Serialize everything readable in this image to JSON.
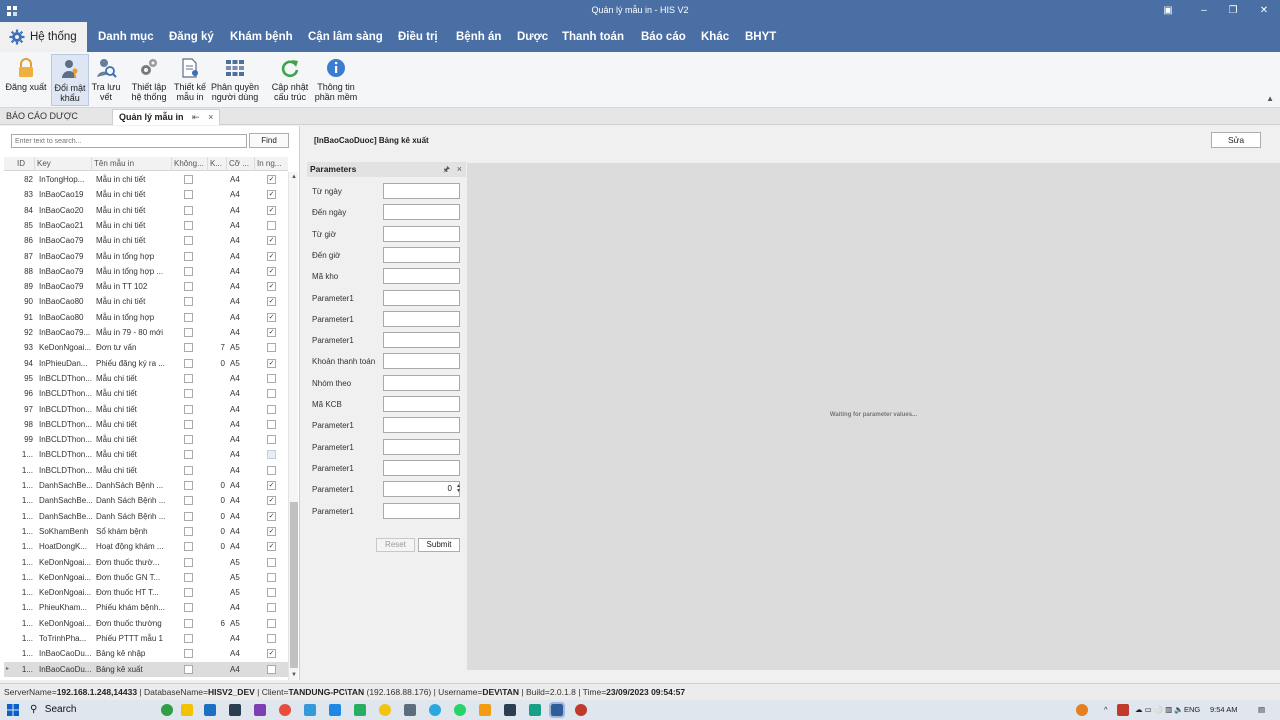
{
  "window": {
    "title": "Quản lý mẫu in - HIS V2",
    "minimize_icon": "minimize-icon",
    "maximize_icon": "restore-icon",
    "close_icon": "close-icon"
  },
  "ribbon_tabs": [
    {
      "label": "Hệ thống",
      "active": true
    },
    {
      "label": "Danh mục"
    },
    {
      "label": "Đăng ký"
    },
    {
      "label": "Khám bệnh"
    },
    {
      "label": "Cận lâm sàng"
    },
    {
      "label": "Điều trị"
    },
    {
      "label": "Bệnh án"
    },
    {
      "label": "Dược"
    },
    {
      "label": "Thanh toán"
    },
    {
      "label": "Báo cáo"
    },
    {
      "label": "Khác"
    },
    {
      "label": "BHYT"
    }
  ],
  "ribbon_buttons": [
    {
      "line1": "Đăng xuất",
      "line2": "",
      "icon": "lock-icon"
    },
    {
      "line1": "Đổi mật",
      "line2": "khẩu",
      "icon": "user-key-icon"
    },
    {
      "line1": "Tra lưu",
      "line2": "vết",
      "icon": "user-search-icon"
    },
    {
      "line1": "Thiết lập",
      "line2": "hệ thống",
      "icon": "gears-icon"
    },
    {
      "line1": "Thiết kế",
      "line2": "mẫu in",
      "icon": "document-design-icon"
    },
    {
      "line1": "Phân quyền",
      "line2": "người dùng",
      "icon": "grid-users-icon"
    },
    {
      "line1": "Cập nhật",
      "line2": "cấu trúc",
      "icon": "refresh-icon"
    },
    {
      "line1": "Thông tin",
      "line2": "phần mềm",
      "icon": "info-icon"
    }
  ],
  "doc_tabs": [
    {
      "label": "BÁO CÁO DƯỢC"
    },
    {
      "label": "Quản lý mẫu in",
      "active": true,
      "pin": "⇤",
      "close": "×"
    }
  ],
  "search": {
    "placeholder": "Enter text to search...",
    "find_label": "Find"
  },
  "grid": {
    "headers": [
      "ID",
      "Key",
      "Tên mẫu in",
      "Không...",
      "K...",
      "Cỡ ...",
      "In ng..."
    ],
    "rows": [
      {
        "id": "82",
        "key": "InTongHop...",
        "name": "Mẫu in chi tiết",
        "k": "",
        "size": "A4",
        "c1": false,
        "c2": true
      },
      {
        "id": "83",
        "key": "InBaoCao19",
        "name": "Mẫu in chi tiết",
        "k": "",
        "size": "A4",
        "c1": false,
        "c2": true
      },
      {
        "id": "84",
        "key": "InBaoCao20",
        "name": "Mẫu in chi tiết",
        "k": "",
        "size": "A4",
        "c1": false,
        "c2": true
      },
      {
        "id": "85",
        "key": "InBaoCao21",
        "name": "Mẫu in chi tiết",
        "k": "",
        "size": "A4",
        "c1": false,
        "c2": false
      },
      {
        "id": "86",
        "key": "InBaoCao79",
        "name": "Mẫu in chi tiết",
        "k": "",
        "size": "A4",
        "c1": false,
        "c2": true
      },
      {
        "id": "87",
        "key": "InBaoCao79",
        "name": "Mẫu in tổng hợp",
        "k": "",
        "size": "A4",
        "c1": false,
        "c2": true
      },
      {
        "id": "88",
        "key": "InBaoCao79",
        "name": "Mẫu in tổng hợp ...",
        "k": "",
        "size": "A4",
        "c1": false,
        "c2": true
      },
      {
        "id": "89",
        "key": "InBaoCao79",
        "name": "Mẫu in TT 102",
        "k": "",
        "size": "A4",
        "c1": false,
        "c2": true
      },
      {
        "id": "90",
        "key": "InBaoCao80",
        "name": "Mẫu in chi tiết",
        "k": "",
        "size": "A4",
        "c1": false,
        "c2": true
      },
      {
        "id": "91",
        "key": "InBaoCao80",
        "name": "Mẫu in tổng hợp",
        "k": "",
        "size": "A4",
        "c1": false,
        "c2": true
      },
      {
        "id": "92",
        "key": "InBaoCao79...",
        "name": "Mẫu in 79 - 80 mới",
        "k": "",
        "size": "A4",
        "c1": false,
        "c2": true
      },
      {
        "id": "93",
        "key": "KeDonNgoai...",
        "name": "Đơn tư vấn",
        "k": "7",
        "size": "A5",
        "c1": false,
        "c2": false
      },
      {
        "id": "94",
        "key": "InPhieuDan...",
        "name": "Phiếu đăng ký ra ...",
        "k": "0",
        "size": "A5",
        "c1": false,
        "c2": true
      },
      {
        "id": "95",
        "key": "InBCLDThon...",
        "name": "Mẫu chi tiết",
        "k": "",
        "size": "A4",
        "c1": false,
        "c2": false
      },
      {
        "id": "96",
        "key": "InBCLDThon...",
        "name": "Mẫu chi tiết",
        "k": "",
        "size": "A4",
        "c1": false,
        "c2": false
      },
      {
        "id": "97",
        "key": "InBCLDThon...",
        "name": "Mẫu chi tiết",
        "k": "",
        "size": "A4",
        "c1": false,
        "c2": false
      },
      {
        "id": "98",
        "key": "InBCLDThon...",
        "name": "Mẫu chi tiết",
        "k": "",
        "size": "A4",
        "c1": false,
        "c2": false
      },
      {
        "id": "99",
        "key": "InBCLDThon...",
        "name": "Mẫu chi tiết",
        "k": "",
        "size": "A4",
        "c1": false,
        "c2": false
      },
      {
        "id": "1...",
        "key": "InBCLDThon...",
        "name": "Mẫu chi tiết",
        "k": "",
        "size": "A4",
        "c1": false,
        "c2": false,
        "c2dim": true
      },
      {
        "id": "1...",
        "key": "InBCLDThon...",
        "name": "Mẫu chi tiết",
        "k": "",
        "size": "A4",
        "c1": false,
        "c2": false
      },
      {
        "id": "1...",
        "key": "DanhSachBe...",
        "name": "DanhSách Bệnh ...",
        "k": "0",
        "size": "A4",
        "c1": false,
        "c2": true
      },
      {
        "id": "1...",
        "key": "DanhSachBe...",
        "name": "Danh Sách Bệnh ...",
        "k": "0",
        "size": "A4",
        "c1": false,
        "c2": true
      },
      {
        "id": "1...",
        "key": "DanhSachBe...",
        "name": "Danh Sách Bệnh ...",
        "k": "0",
        "size": "A4",
        "c1": false,
        "c2": true
      },
      {
        "id": "1...",
        "key": "SoKhamBenh",
        "name": "Sổ khám bệnh",
        "k": "0",
        "size": "A4",
        "c1": false,
        "c2": true
      },
      {
        "id": "1...",
        "key": "HoatDongK...",
        "name": "Hoạt động khám ...",
        "k": "0",
        "size": "A4",
        "c1": false,
        "c2": true
      },
      {
        "id": "1...",
        "key": "KeDonNgoai...",
        "name": "Đơn thuốc thườ...",
        "k": "",
        "size": "A5",
        "c1": false,
        "c2": false
      },
      {
        "id": "1...",
        "key": "KeDonNgoai...",
        "name": "Đơn thuốc GN T...",
        "k": "",
        "size": "A5",
        "c1": false,
        "c2": false
      },
      {
        "id": "1...",
        "key": "KeDonNgoai...",
        "name": "Đơn thuốc HT T...",
        "k": "",
        "size": "A5",
        "c1": false,
        "c2": false
      },
      {
        "id": "1...",
        "key": "PhieuKham...",
        "name": "Phiếu khám bệnh...",
        "k": "",
        "size": "A4",
        "c1": false,
        "c2": false
      },
      {
        "id": "1...",
        "key": "KeDonNgoai...",
        "name": "Đơn thuốc thường",
        "k": "6",
        "size": "A5",
        "c1": false,
        "c2": false
      },
      {
        "id": "1...",
        "key": "ToTrinhPha...",
        "name": "Phiếu PTTT mẫu 1",
        "k": "",
        "size": "A4",
        "c1": false,
        "c2": false
      },
      {
        "id": "1...",
        "key": "InBaoCaoDu...",
        "name": "Bảng kê nhập",
        "k": "",
        "size": "A4",
        "c1": false,
        "c2": true
      },
      {
        "id": "1...",
        "key": "InBaoCaoDu...",
        "name": "Bảng kê xuất",
        "k": "",
        "size": "A4",
        "c1": false,
        "c2": false,
        "selected": true
      }
    ]
  },
  "report": {
    "title": "[InBaoCaoDuoc] Bảng kê xuất",
    "edit_label": "Sửa"
  },
  "parameters": {
    "header": "Parameters",
    "pin": "🖈",
    "close": "×",
    "fields": [
      {
        "label": "Từ ngày",
        "value": ""
      },
      {
        "label": "Đến ngày",
        "value": ""
      },
      {
        "label": "Từ giờ",
        "value": ""
      },
      {
        "label": "Đến giờ",
        "value": ""
      },
      {
        "label": "Mã kho",
        "value": ""
      },
      {
        "label": "Parameter1",
        "value": ""
      },
      {
        "label": "Parameter1",
        "value": ""
      },
      {
        "label": "Parameter1",
        "value": ""
      },
      {
        "label": "Khoản thanh toán",
        "value": ""
      },
      {
        "label": "Nhóm theo",
        "value": ""
      },
      {
        "label": "Mã KCB",
        "value": ""
      },
      {
        "label": "Parameter1",
        "value": ""
      },
      {
        "label": "Parameter1",
        "value": ""
      },
      {
        "label": "Parameter1",
        "value": ""
      },
      {
        "label": "Parameter1",
        "value": "0",
        "spinner": true
      },
      {
        "label": "Parameter1",
        "value": ""
      }
    ],
    "reset_label": "Reset",
    "submit_label": "Submit"
  },
  "viewer": {
    "waiting_text": "Waiting for parameter values..."
  },
  "statusbar": {
    "server_label": "ServerName=",
    "server": "192.168.1.248,14433",
    "db_label": " | DatabaseName=",
    "db": "HISV2_DEV",
    "client_label": " | Client=",
    "client": "TANDUNG-PC\\TAN",
    "client_ip": " (192.168.88.176)",
    "user_label": " | Username=",
    "user": "DEV\\TAN",
    "build_label": " | Build=2.0.1.8",
    "time_label": " | Time=",
    "time": "23/09/2023 09:54:57"
  },
  "taskbar": {
    "search_label": "Search",
    "lang": "ENG",
    "clock": "9:54 AM"
  },
  "colors": {
    "title_bar": "#4a6fa5",
    "ribbon_bg": "#f5f6f7",
    "viewer_bg": "#dcdcdc"
  }
}
